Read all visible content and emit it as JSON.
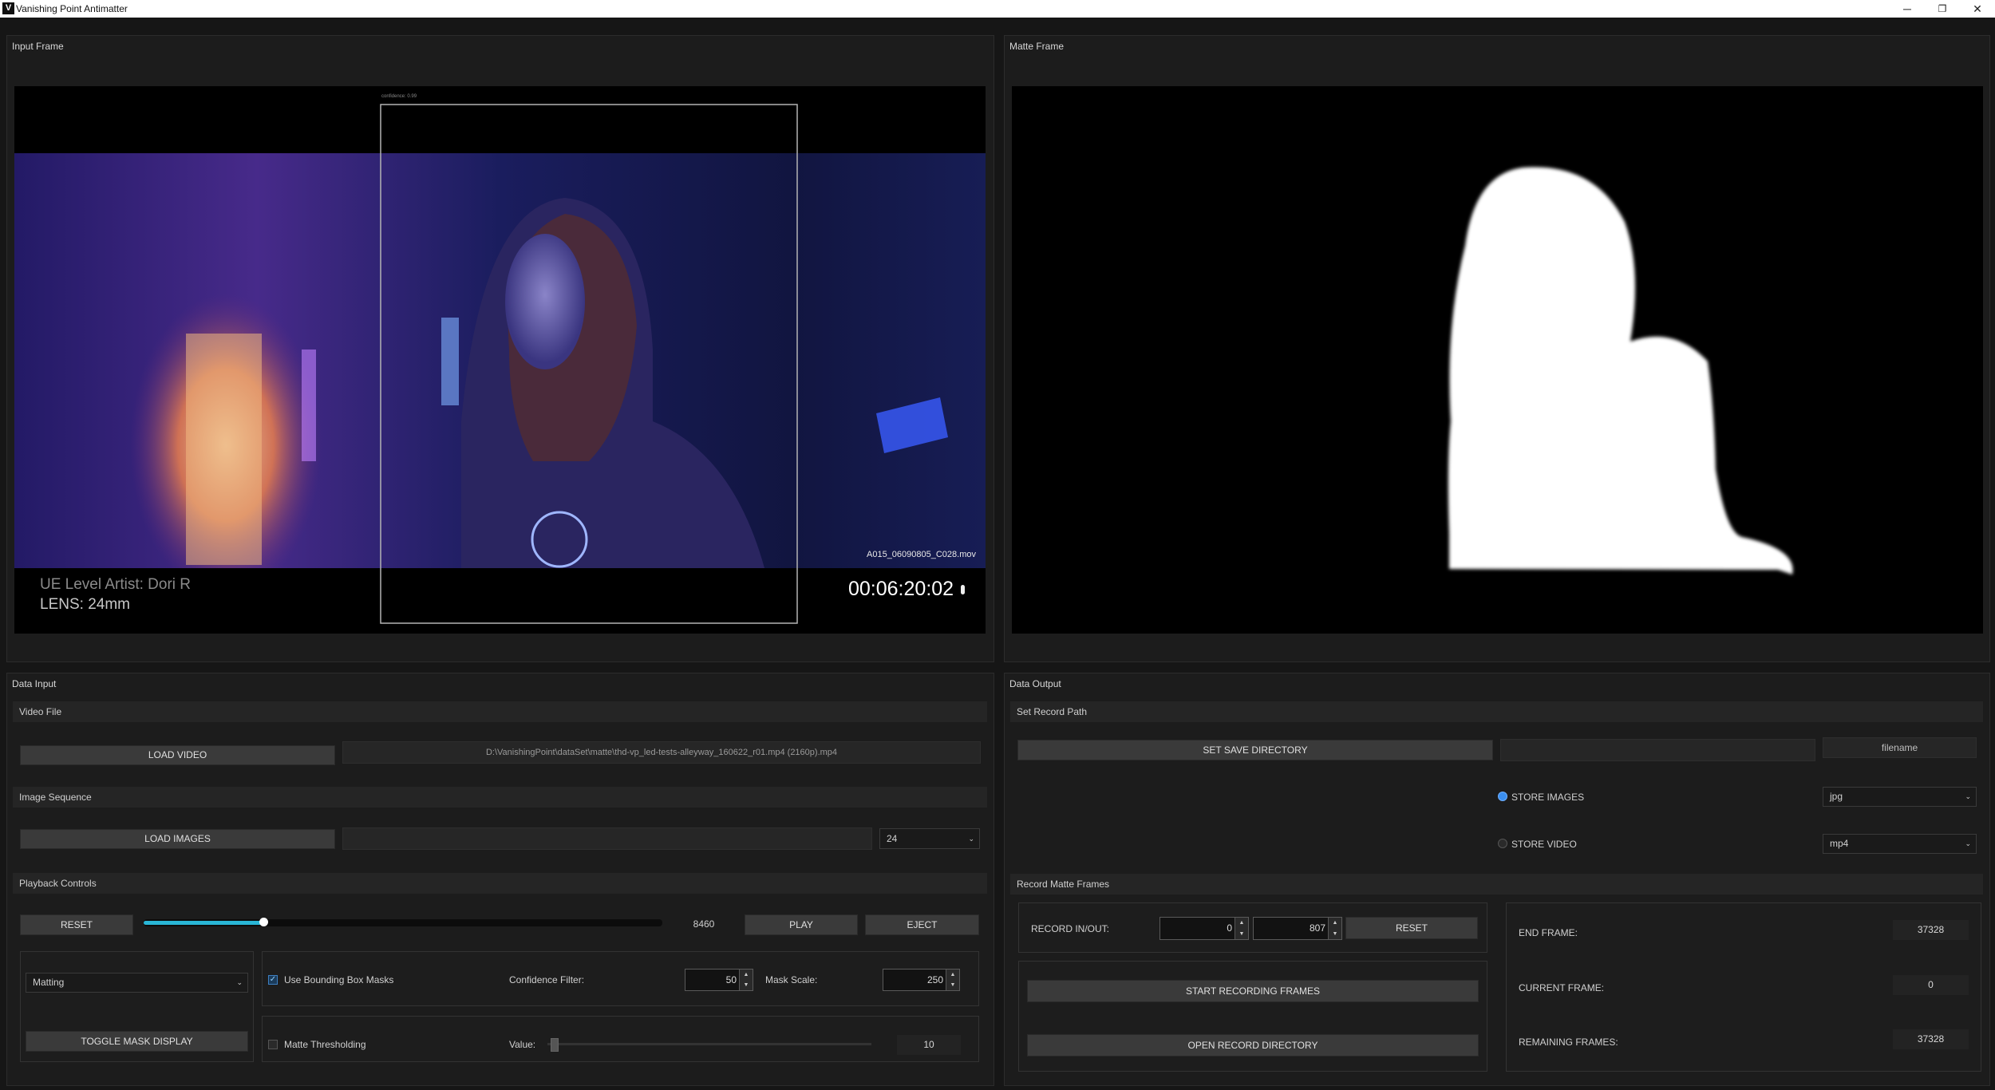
{
  "window": {
    "title": "Vanishing Point Antimatter",
    "icon_letter": "V",
    "controls": [
      "─",
      "❐",
      "✕"
    ]
  },
  "input_panel": {
    "title": "Input Frame",
    "overlay": {
      "artist": "UE Level Artist: Dori R",
      "lens": "LENS: 24mm",
      "clip": "A015_06090805_C028.mov",
      "timecode": "00:06:20:02",
      "bbox_label": "confidence: 0.99"
    }
  },
  "matte_panel": {
    "title": "Matte Frame"
  },
  "data_input": {
    "title": "Data Input",
    "video_file": {
      "header": "Video File",
      "load_label": "LOAD VIDEO",
      "path": "D:\\VanishingPoint\\dataSet\\matte\\thd-vp_led-tests-alleyway_160622_r01.mp4 (2160p).mp4"
    },
    "image_sequence": {
      "header": "Image Sequence",
      "load_label": "LOAD IMAGES",
      "path": "",
      "fps": "24"
    },
    "playback": {
      "header": "Playback Controls",
      "reset_label": "RESET",
      "frame": "8460",
      "progress": 0.23,
      "play_label": "PLAY",
      "eject_label": "EJECT",
      "mode": "Matting",
      "toggle_label": "TOGGLE MASK DISPLAY",
      "use_bbox_label": "Use Bounding Box Masks",
      "use_bbox_checked": true,
      "confidence_label": "Confidence Filter:",
      "confidence_value": "50",
      "mask_scale_label": "Mask Scale:",
      "mask_scale_value": "250",
      "threshold_label": "Matte Thresholding",
      "threshold_checked": false,
      "value_label": "Value:",
      "value": "10",
      "value_fraction": 0.02
    }
  },
  "data_output": {
    "title": "Data Output",
    "record_path": {
      "header": "Set Record Path",
      "set_dir_label": "SET SAVE DIRECTORY",
      "dir_value": "",
      "filename": "filename",
      "store_images_label": "STORE IMAGES",
      "store_images_checked": true,
      "image_format": "jpg",
      "store_video_label": "STORE VIDEO",
      "store_video_checked": false,
      "video_format": "mp4"
    },
    "record_matte": {
      "header": "Record Matte Frames",
      "in_out_label": "RECORD IN/OUT:",
      "in_value": "0",
      "out_value": "807",
      "reset_label": "RESET",
      "start_label": "START RECORDING FRAMES",
      "open_label": "OPEN RECORD DIRECTORY",
      "end_frame_label": "END FRAME:",
      "end_frame": "37328",
      "current_frame_label": "CURRENT FRAME:",
      "current_frame": "0",
      "remaining_label": "REMAINING FRAMES:",
      "remaining": "37328"
    }
  }
}
